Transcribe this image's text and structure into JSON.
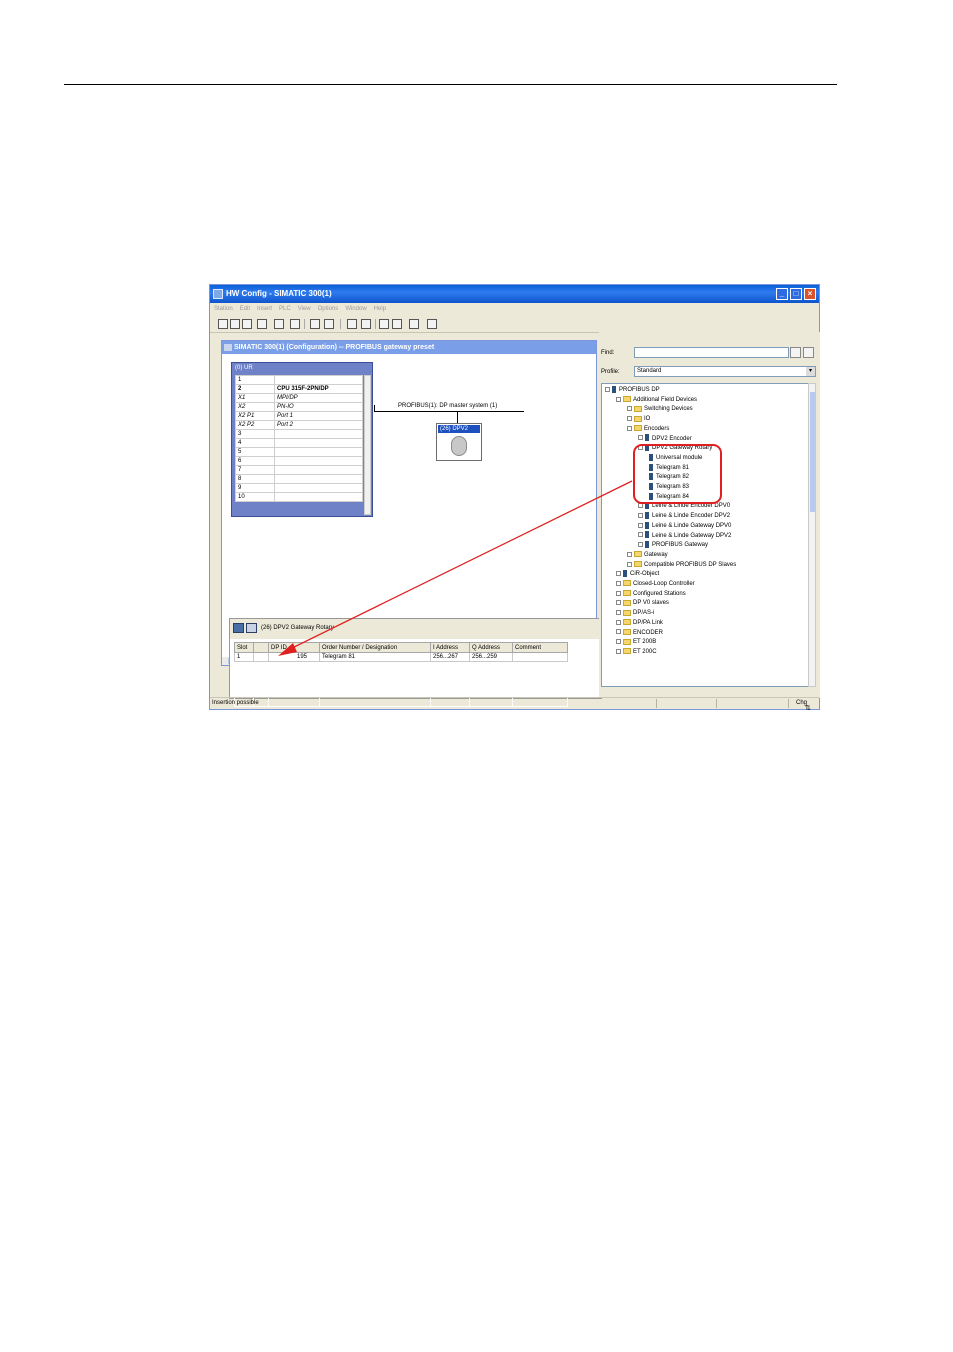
{
  "window": {
    "title": "HW Config - SIMATIC 300(1)",
    "menu": [
      "Station",
      "Edit",
      "Insert",
      "PLC",
      "View",
      "Options",
      "Window",
      "Help"
    ]
  },
  "document": {
    "title": "SIMATIC 300(1) (Configuration) -- PROFIBUS gateway preset",
    "rack": {
      "title": "(0) UR",
      "rows": [
        {
          "slot": "1",
          "module": ""
        },
        {
          "slot": "2",
          "module": "CPU 315F-2PN/DP"
        },
        {
          "slot": "X1",
          "module": "MPI/DP"
        },
        {
          "slot": "X2",
          "module": "PN-IO"
        },
        {
          "slot": "X2 P1",
          "module": "Port 1"
        },
        {
          "slot": "X2 P2",
          "module": "Port 2"
        },
        {
          "slot": "3",
          "module": ""
        },
        {
          "slot": "4",
          "module": ""
        },
        {
          "slot": "5",
          "module": ""
        },
        {
          "slot": "6",
          "module": ""
        },
        {
          "slot": "7",
          "module": ""
        },
        {
          "slot": "8",
          "module": ""
        },
        {
          "slot": "9",
          "module": ""
        },
        {
          "slot": "10",
          "module": ""
        }
      ]
    },
    "bus_label": "PROFIBUS(1): DP master system (1)",
    "slave_label": "(26) DPV2"
  },
  "detail": {
    "title": "(26)  DPV2 Gateway Rotary",
    "columns": [
      "Slot",
      "",
      "DP ID",
      "Order Number / Designation",
      "I Address",
      "Q Address",
      "Comment"
    ],
    "rows": [
      {
        "slot": "1",
        "icon": "",
        "dp_id": "195",
        "order": "Telegram 81",
        "i_addr": "256...267",
        "q_addr": "256...259",
        "comment": ""
      }
    ]
  },
  "catalog": {
    "find_label": "Find:",
    "find_value": "",
    "profile_label": "Profile:",
    "profile_value": "Standard",
    "tree": [
      {
        "label": "PROFIBUS DP",
        "depth": 0,
        "icon": "network-icon"
      },
      {
        "label": "Additional Field Devices",
        "depth": 1,
        "icon": "folder-icon"
      },
      {
        "label": "Switching Devices",
        "depth": 2,
        "icon": "folder-icon"
      },
      {
        "label": "IO",
        "depth": 2,
        "icon": "folder-icon"
      },
      {
        "label": "Encoders",
        "depth": 2,
        "icon": "folder-icon"
      },
      {
        "label": "DPV2 Encoder",
        "depth": 3,
        "icon": "device-icon"
      },
      {
        "label": "DPV2 Gateway Rotary",
        "depth": 3,
        "icon": "device-icon"
      },
      {
        "label": "Universal module",
        "depth": 4,
        "icon": "module-icon"
      },
      {
        "label": "Telegram 81",
        "depth": 4,
        "icon": "module-icon"
      },
      {
        "label": "Telegram 82",
        "depth": 4,
        "icon": "module-icon"
      },
      {
        "label": "Telegram 83",
        "depth": 4,
        "icon": "module-icon"
      },
      {
        "label": "Telegram 84",
        "depth": 4,
        "icon": "module-icon"
      },
      {
        "label": "Leine & Linde Encoder DPV0",
        "depth": 3,
        "icon": "device-icon"
      },
      {
        "label": "Leine & Linde Encoder DPV2",
        "depth": 3,
        "icon": "device-icon"
      },
      {
        "label": "Leine & Linde Gateway DPV0",
        "depth": 3,
        "icon": "device-icon"
      },
      {
        "label": "Leine & Linde Gateway DPV2",
        "depth": 3,
        "icon": "device-icon"
      },
      {
        "label": "PROFIBUS Gateway",
        "depth": 3,
        "icon": "device-icon"
      },
      {
        "label": "Gateway",
        "depth": 2,
        "icon": "folder-icon"
      },
      {
        "label": "Compatible PROFIBUS DP Slaves",
        "depth": 2,
        "icon": "folder-icon"
      },
      {
        "label": "CiR-Object",
        "depth": 1,
        "icon": "cir-icon"
      },
      {
        "label": "Closed-Loop Controller",
        "depth": 1,
        "icon": "folder-icon"
      },
      {
        "label": "Configured Stations",
        "depth": 1,
        "icon": "folder-icon"
      },
      {
        "label": "DP V0 slaves",
        "depth": 1,
        "icon": "folder-icon"
      },
      {
        "label": "DP/AS-i",
        "depth": 1,
        "icon": "folder-icon"
      },
      {
        "label": "DP/PA Link",
        "depth": 1,
        "icon": "folder-icon"
      },
      {
        "label": "ENCODER",
        "depth": 1,
        "icon": "folder-icon"
      },
      {
        "label": "ET 200B",
        "depth": 1,
        "icon": "folder-icon"
      },
      {
        "label": "ET 200C",
        "depth": 1,
        "icon": "folder-icon"
      }
    ]
  },
  "status": {
    "left": "Insertion possible",
    "right": "Chg"
  },
  "colors": {
    "title_bar": "#0A5FD8",
    "highlight": "#E02020",
    "rack_frame": "#6F82C8"
  }
}
